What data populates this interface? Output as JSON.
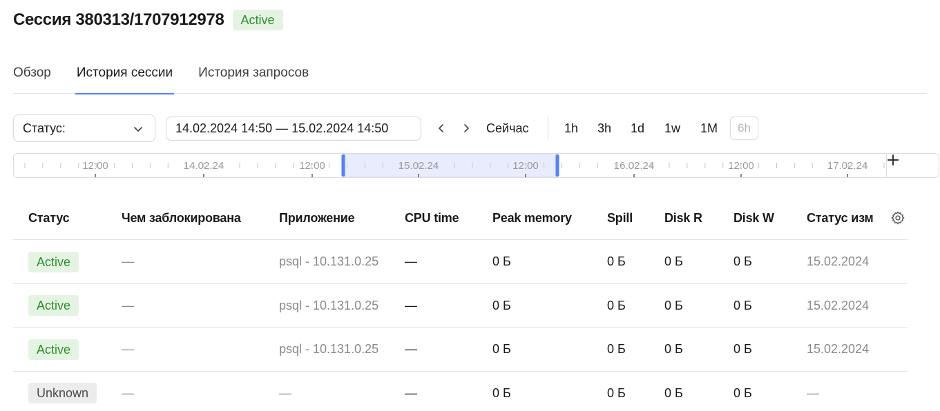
{
  "header": {
    "title": "Сессия 380313/1707912978",
    "status": "Active"
  },
  "tabs": [
    {
      "label": "Обзор",
      "active": false
    },
    {
      "label": "История сессии",
      "active": true
    },
    {
      "label": "История запросов",
      "active": false
    }
  ],
  "toolbar": {
    "status_label": "Статус:",
    "range_value": "14.02.2024 14:50 — 15.02.2024 14:50",
    "now_label": "Сейчас",
    "presets": [
      "1h",
      "3h",
      "1d",
      "1w",
      "1M"
    ],
    "current_preset": "6h"
  },
  "timeline": {
    "labels": [
      "12:00",
      "14.02.24",
      "12:00",
      "15.02.24",
      "12:00",
      "16.02.24",
      "12:00",
      "17.02.24"
    ],
    "selection": {
      "from": "14.02.2024 14:50",
      "to": "15.02.2024 14:50"
    }
  },
  "table": {
    "columns": [
      "Статус",
      "Чем заблокирована",
      "Приложение",
      "CPU time",
      "Peak memory",
      "Spill",
      "Disk R",
      "Disk W",
      "Статус изм"
    ],
    "rows": [
      {
        "status": "Active",
        "blocked_by": "—",
        "app": "psql - 10.131.0.25",
        "cpu": "—",
        "peak_memory": "0 Б",
        "spill": "0 Б",
        "disk_r": "0 Б",
        "disk_w": "0 Б",
        "status_changed": "15.02.2024"
      },
      {
        "status": "Active",
        "blocked_by": "—",
        "app": "psql - 10.131.0.25",
        "cpu": "—",
        "peak_memory": "0 Б",
        "spill": "0 Б",
        "disk_r": "0 Б",
        "disk_w": "0 Б",
        "status_changed": "15.02.2024"
      },
      {
        "status": "Active",
        "blocked_by": "—",
        "app": "psql - 10.131.0.25",
        "cpu": "—",
        "peak_memory": "0 Б",
        "spill": "0 Б",
        "disk_r": "0 Б",
        "disk_w": "0 Б",
        "status_changed": "15.02.2024"
      },
      {
        "status": "Unknown",
        "blocked_by": "—",
        "app": "—",
        "cpu": "—",
        "peak_memory": "0 Б",
        "spill": "0 Б",
        "disk_r": "0 Б",
        "disk_w": "0 Б",
        "status_changed": "—"
      }
    ]
  },
  "icons": {
    "select_chevron": "chevron-down-icon",
    "prev": "chevron-left-icon",
    "next": "chevron-right-icon",
    "zoom_out": "minus-icon",
    "zoom_in": "plus-icon",
    "settings": "gear-icon"
  },
  "colors": {
    "accent": "#5282ff",
    "selection_fill": "#e8ecfd",
    "active_badge_bg": "#e5f4e2",
    "active_badge_text": "#2b8f2b",
    "unknown_badge_bg": "#ececec"
  }
}
